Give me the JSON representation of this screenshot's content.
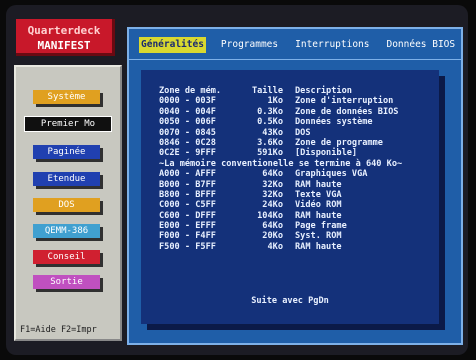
{
  "logo": {
    "line1": "Quarterdeck",
    "line2": "MANIFEST"
  },
  "sidebar": {
    "items": [
      {
        "label": "Système",
        "color": "#e0a020"
      },
      {
        "label": "Premier Mo",
        "color": "#101010",
        "selected": true
      },
      {
        "label": "Paginée",
        "color": "#2040b0"
      },
      {
        "label": "Etendue",
        "color": "#2040b0"
      },
      {
        "label": "DOS",
        "color": "#e0a020"
      },
      {
        "label": "QEMM-386",
        "color": "#40a0d0"
      },
      {
        "label": "Conseil",
        "color": "#d02030"
      },
      {
        "label": "Sortie",
        "color": "#c050c0"
      }
    ],
    "help": "F1=Aide  F2=Impr"
  },
  "tabs": [
    {
      "label": "Généralités",
      "active": true
    },
    {
      "label": "Programmes"
    },
    {
      "label": "Interruptions"
    },
    {
      "label": "Données BIOS"
    }
  ],
  "table": {
    "headers": [
      "Zone de mém.",
      "Taille",
      "Description"
    ],
    "rows": [
      {
        "zone": "0000 - 003F",
        "size": "1Ko",
        "desc": "Zone d'interruption"
      },
      {
        "zone": "0040 - 004F",
        "size": "0.3Ko",
        "desc": "Zone de données BIOS"
      },
      {
        "zone": "0050 - 006F",
        "size": "0.5Ko",
        "desc": "Données système"
      },
      {
        "zone": "0070 - 0845",
        "size": "43Ko",
        "desc": "DOS"
      },
      {
        "zone": "0846 - 0C28",
        "size": "3.6Ko",
        "desc": "Zone de programme"
      },
      {
        "zone": "0C2E - 9FFF",
        "size": "591Ko",
        "desc": "[Disponible]"
      }
    ],
    "notice": "~La mémoire conventionelle se termine à 640 Ko~",
    "rows2": [
      {
        "zone": "A000 - AFFF",
        "size": "64Ko",
        "desc": "Graphiques VGA"
      },
      {
        "zone": "B000 - B7FF",
        "size": "32Ko",
        "desc": "RAM haute"
      },
      {
        "zone": "B800 - BFFF",
        "size": "32Ko",
        "desc": "Texte VGA"
      },
      {
        "zone": "C000 - C5FF",
        "size": "24Ko",
        "desc": "Vidéo ROM"
      },
      {
        "zone": "C600 - DFFF",
        "size": "104Ko",
        "desc": "RAM haute"
      },
      {
        "zone": "E000 - EFFF",
        "size": "64Ko",
        "desc": "Page frame"
      },
      {
        "zone": "F000 - F4FF",
        "size": "20Ko",
        "desc": "Syst. ROM"
      },
      {
        "zone": "F500 - F5FF",
        "size": "4Ko",
        "desc": "RAM haute"
      }
    ],
    "footer": "Suite avec PgDn"
  }
}
